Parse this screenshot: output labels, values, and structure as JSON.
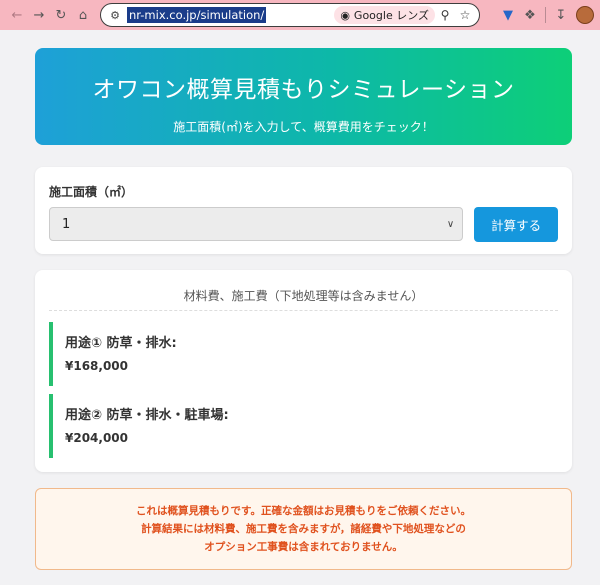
{
  "browser": {
    "url": "nr-mix.co.jp/simulation/",
    "lens_label": "Google レンズ"
  },
  "hero": {
    "title": "オワコン概算見積もりシミュレーション",
    "subtitle": "施工面積(㎡)を入力して、概算費用をチェック！"
  },
  "form": {
    "area_label": "施工面積（㎡）",
    "area_value": "1",
    "calc_button": "計算する"
  },
  "results": {
    "heading": "材料費、施工費（下地処理等は含みません）",
    "items": [
      {
        "title": "用途① 防草・排水:",
        "price": "¥168,000"
      },
      {
        "title": "用途② 防草・排水・駐車場:",
        "price": "¥204,000"
      }
    ]
  },
  "notice": {
    "line1": "これは概算見積もりです。正確な金額はお見積もりをご依頼ください。",
    "line2": "計算結果には材料費、施工費を含みますが，諸経費や下地処理などの",
    "line3": "オプション工事費は含まれておりません。"
  },
  "colors": {
    "hero_gradient_start": "#1ea0d8",
    "hero_gradient_end": "#0dcf78",
    "accent_green": "#27c070",
    "button_blue": "#1597dd",
    "notice_text": "#e0521f"
  },
  "icons": [
    "back-icon",
    "forward-icon",
    "reload-icon",
    "home-icon",
    "site-info-icon",
    "lens-icon",
    "search-icon",
    "star-icon",
    "shield-extension-icon",
    "puzzle-extension-icon",
    "download-icon",
    "profile-avatar"
  ]
}
